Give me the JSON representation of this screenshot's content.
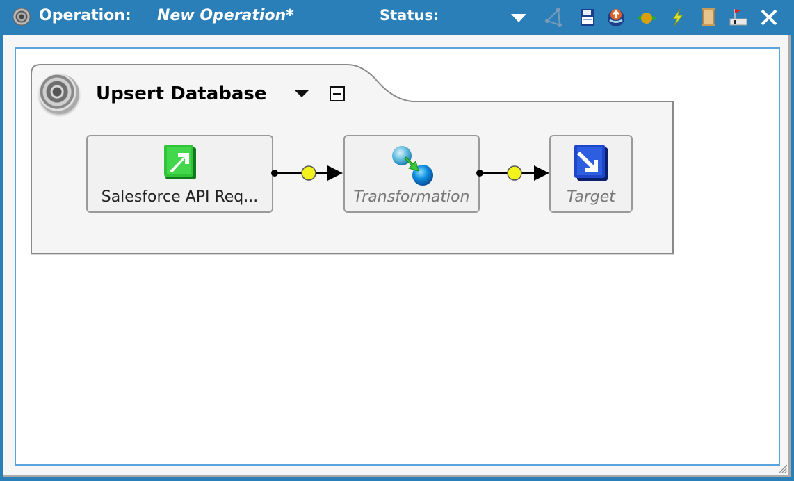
{
  "titlebar": {
    "label": "Operation:",
    "operation_name": "New Operation*",
    "status_label": "Status:",
    "colors": {
      "background": "#2b7fb8",
      "text": "#ffffff"
    },
    "toolbar_icons": [
      "status-dropdown-icon",
      "graph-icon",
      "save-icon",
      "deploy-icon",
      "test-icon",
      "run-icon",
      "log-icon",
      "schedule-icon",
      "close-icon"
    ]
  },
  "canvas": {
    "border_color": "#5aa4dd",
    "group": {
      "title": "Upsert Database",
      "icon": "operation-gear-icon",
      "nodes": [
        {
          "label": "Salesforce API Req...",
          "icon": "source-arrow-icon",
          "active": true
        },
        {
          "label": "Transformation",
          "icon": "transformation-icon",
          "active": false
        },
        {
          "label": "Target",
          "icon": "target-arrow-icon",
          "active": false
        }
      ]
    }
  }
}
